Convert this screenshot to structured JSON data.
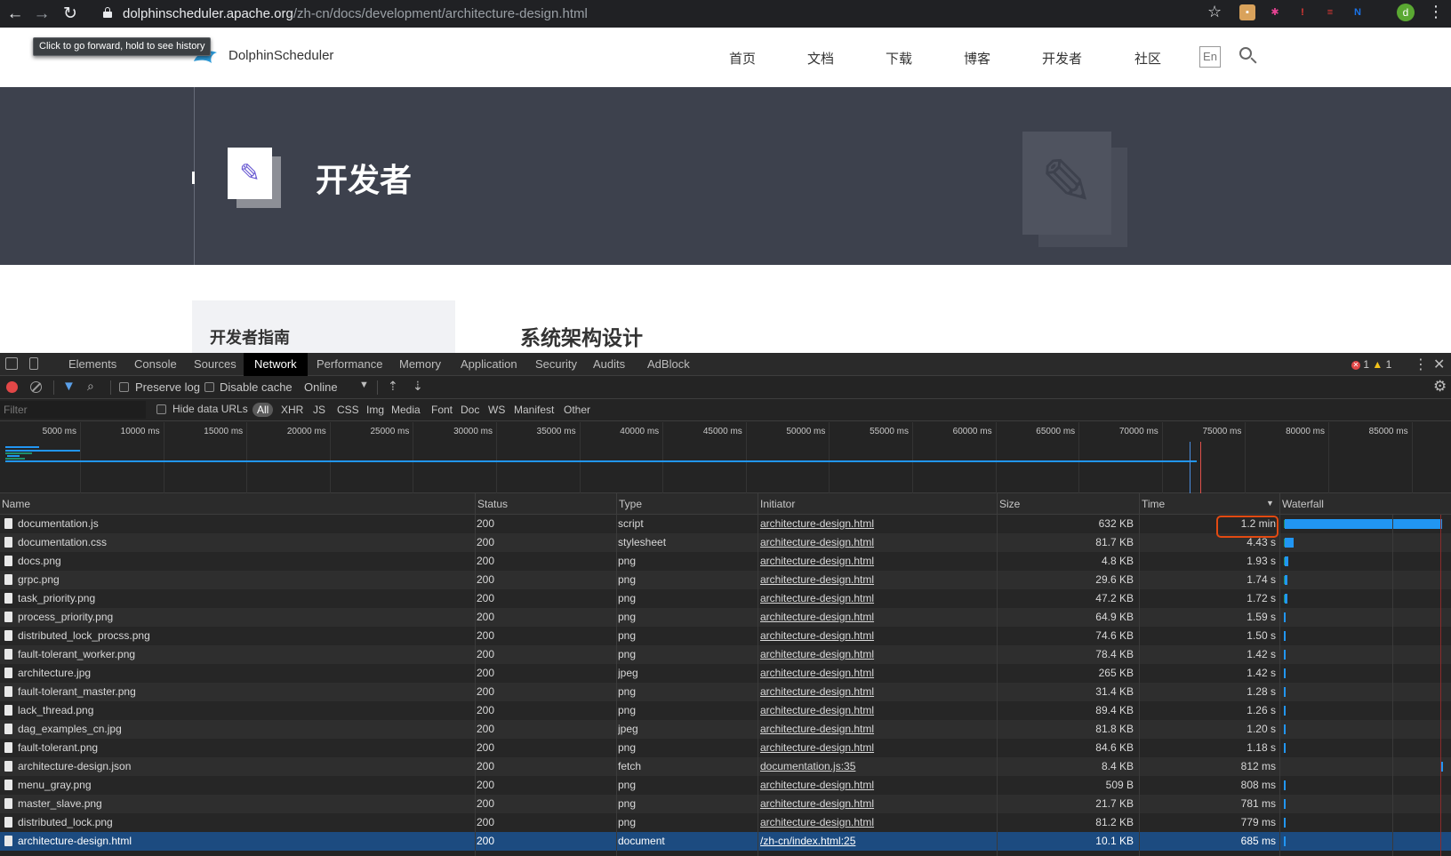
{
  "browser": {
    "url_host": "dolphinscheduler.apache.org",
    "url_path": "/zh-cn/docs/development/architecture-design.html",
    "back_glyph": "←",
    "forward_glyph": "→",
    "reload_glyph": "↻",
    "star_glyph": "☆",
    "avatar_letter": "d",
    "menu_glyph": "⋮",
    "tooltip": "Click to go forward, hold to see history",
    "extensions": [
      {
        "name": "extension-icon-face",
        "glyph": "▪",
        "color": "#d9a25b"
      },
      {
        "name": "extension-icon-asterisk",
        "glyph": "✱",
        "color": "#1e1e1e"
      },
      {
        "name": "extension-icon-warning",
        "glyph": "!",
        "color": "#c62828"
      },
      {
        "name": "extension-icon-list",
        "glyph": "≡",
        "color": "#e53935"
      },
      {
        "name": "extension-icon-n",
        "glyph": "N",
        "color": "#202124"
      }
    ]
  },
  "site": {
    "logo_text": "DolphinScheduler",
    "nav": [
      "首页",
      "文档",
      "下载",
      "博客",
      "开发者",
      "社区"
    ],
    "lang_toggle": "En",
    "hero_title": "开发者",
    "hero_icon_glyph": "✎",
    "sidebar_heading": "开发者指南",
    "doc_title": "系统架构设计"
  },
  "devtools": {
    "tabs": [
      "Elements",
      "Console",
      "Sources",
      "Network",
      "Performance",
      "Memory",
      "Application",
      "Security",
      "Audits",
      "AdBlock"
    ],
    "active_tab": "Network",
    "error_count": "1",
    "warning_count": "1",
    "toolbar": {
      "preserve_log": "Preserve log",
      "disable_cache": "Disable cache",
      "throttling": "Online"
    },
    "filter_placeholder": "Filter",
    "hide_data_urls": "Hide data URLs",
    "type_filters": [
      "All",
      "XHR",
      "JS",
      "CSS",
      "Img",
      "Media",
      "Font",
      "Doc",
      "WS",
      "Manifest",
      "Other"
    ],
    "overview_ticks": [
      "5000 ms",
      "10000 ms",
      "15000 ms",
      "20000 ms",
      "25000 ms",
      "30000 ms",
      "35000 ms",
      "40000 ms",
      "45000 ms",
      "50000 ms",
      "55000 ms",
      "60000 ms",
      "65000 ms",
      "70000 ms",
      "75000 ms",
      "80000 ms",
      "85000 ms"
    ],
    "columns": [
      "Name",
      "Status",
      "Type",
      "Initiator",
      "Size",
      "Time",
      "Waterfall"
    ],
    "sort_glyph": "▼",
    "requests": [
      {
        "name": "documentation.js",
        "status": "200",
        "type": "script",
        "initiator": "architecture-design.html",
        "size": "632 KB",
        "time": "1.2 min",
        "wf_start": 0.0,
        "wf_end": 1.0
      },
      {
        "name": "documentation.css",
        "status": "200",
        "type": "stylesheet",
        "initiator": "architecture-design.html",
        "size": "81.7 KB",
        "time": "4.43 s",
        "wf_start": 0.0,
        "wf_end": 0.062
      },
      {
        "name": "docs.png",
        "status": "200",
        "type": "png",
        "initiator": "architecture-design.html",
        "size": "4.8 KB",
        "time": "1.93 s",
        "wf_start": 0.0,
        "wf_end": 0.027
      },
      {
        "name": "grpc.png",
        "status": "200",
        "type": "png",
        "initiator": "architecture-design.html",
        "size": "29.6 KB",
        "time": "1.74 s",
        "wf_start": 0.0,
        "wf_end": 0.024
      },
      {
        "name": "task_priority.png",
        "status": "200",
        "type": "png",
        "initiator": "architecture-design.html",
        "size": "47.2 KB",
        "time": "1.72 s",
        "wf_start": 0.0,
        "wf_end": 0.024
      },
      {
        "name": "process_priority.png",
        "status": "200",
        "type": "png",
        "initiator": "architecture-design.html",
        "size": "64.9 KB",
        "time": "1.59 s",
        "wf_start": 0.0,
        "wf_end": 0.022
      },
      {
        "name": "distributed_lock_procss.png",
        "status": "200",
        "type": "png",
        "initiator": "architecture-design.html",
        "size": "74.6 KB",
        "time": "1.50 s",
        "wf_start": 0.0,
        "wf_end": 0.021
      },
      {
        "name": "fault-tolerant_worker.png",
        "status": "200",
        "type": "png",
        "initiator": "architecture-design.html",
        "size": "78.4 KB",
        "time": "1.42 s",
        "wf_start": 0.0,
        "wf_end": 0.02
      },
      {
        "name": "architecture.jpg",
        "status": "200",
        "type": "jpeg",
        "initiator": "architecture-design.html",
        "size": "265 KB",
        "time": "1.42 s",
        "wf_start": 0.0,
        "wf_end": 0.02
      },
      {
        "name": "fault-tolerant_master.png",
        "status": "200",
        "type": "png",
        "initiator": "architecture-design.html",
        "size": "31.4 KB",
        "time": "1.28 s",
        "wf_start": 0.0,
        "wf_end": 0.018
      },
      {
        "name": "lack_thread.png",
        "status": "200",
        "type": "png",
        "initiator": "architecture-design.html",
        "size": "89.4 KB",
        "time": "1.26 s",
        "wf_start": 0.0,
        "wf_end": 0.018
      },
      {
        "name": "dag_examples_cn.jpg",
        "status": "200",
        "type": "jpeg",
        "initiator": "architecture-design.html",
        "size": "81.8 KB",
        "time": "1.20 s",
        "wf_start": 0.0,
        "wf_end": 0.017
      },
      {
        "name": "fault-tolerant.png",
        "status": "200",
        "type": "png",
        "initiator": "architecture-design.html",
        "size": "84.6 KB",
        "time": "1.18 s",
        "wf_start": 0.0,
        "wf_end": 0.017
      },
      {
        "name": "architecture-design.json",
        "status": "200",
        "type": "fetch",
        "initiator": "documentation.js:35",
        "size": "8.4 KB",
        "time": "812 ms",
        "wf_start": 0.995,
        "wf_end": 1.0
      },
      {
        "name": "menu_gray.png",
        "status": "200",
        "type": "png",
        "initiator": "architecture-design.html",
        "size": "509 B",
        "time": "808 ms",
        "wf_start": 0.0,
        "wf_end": 0.012
      },
      {
        "name": "master_slave.png",
        "status": "200",
        "type": "png",
        "initiator": "architecture-design.html",
        "size": "21.7 KB",
        "time": "781 ms",
        "wf_start": 0.0,
        "wf_end": 0.012
      },
      {
        "name": "distributed_lock.png",
        "status": "200",
        "type": "png",
        "initiator": "architecture-design.html",
        "size": "81.2 KB",
        "time": "779 ms",
        "wf_start": 0.0,
        "wf_end": 0.011
      },
      {
        "name": "architecture-design.html",
        "status": "200",
        "type": "document",
        "initiator": "/zh-cn/index.html:25",
        "size": "10.1 KB",
        "time": "685 ms",
        "wf_start": 0.0,
        "wf_end": 0.01,
        "selected": true
      }
    ],
    "highlight_color": "#e24a12"
  }
}
